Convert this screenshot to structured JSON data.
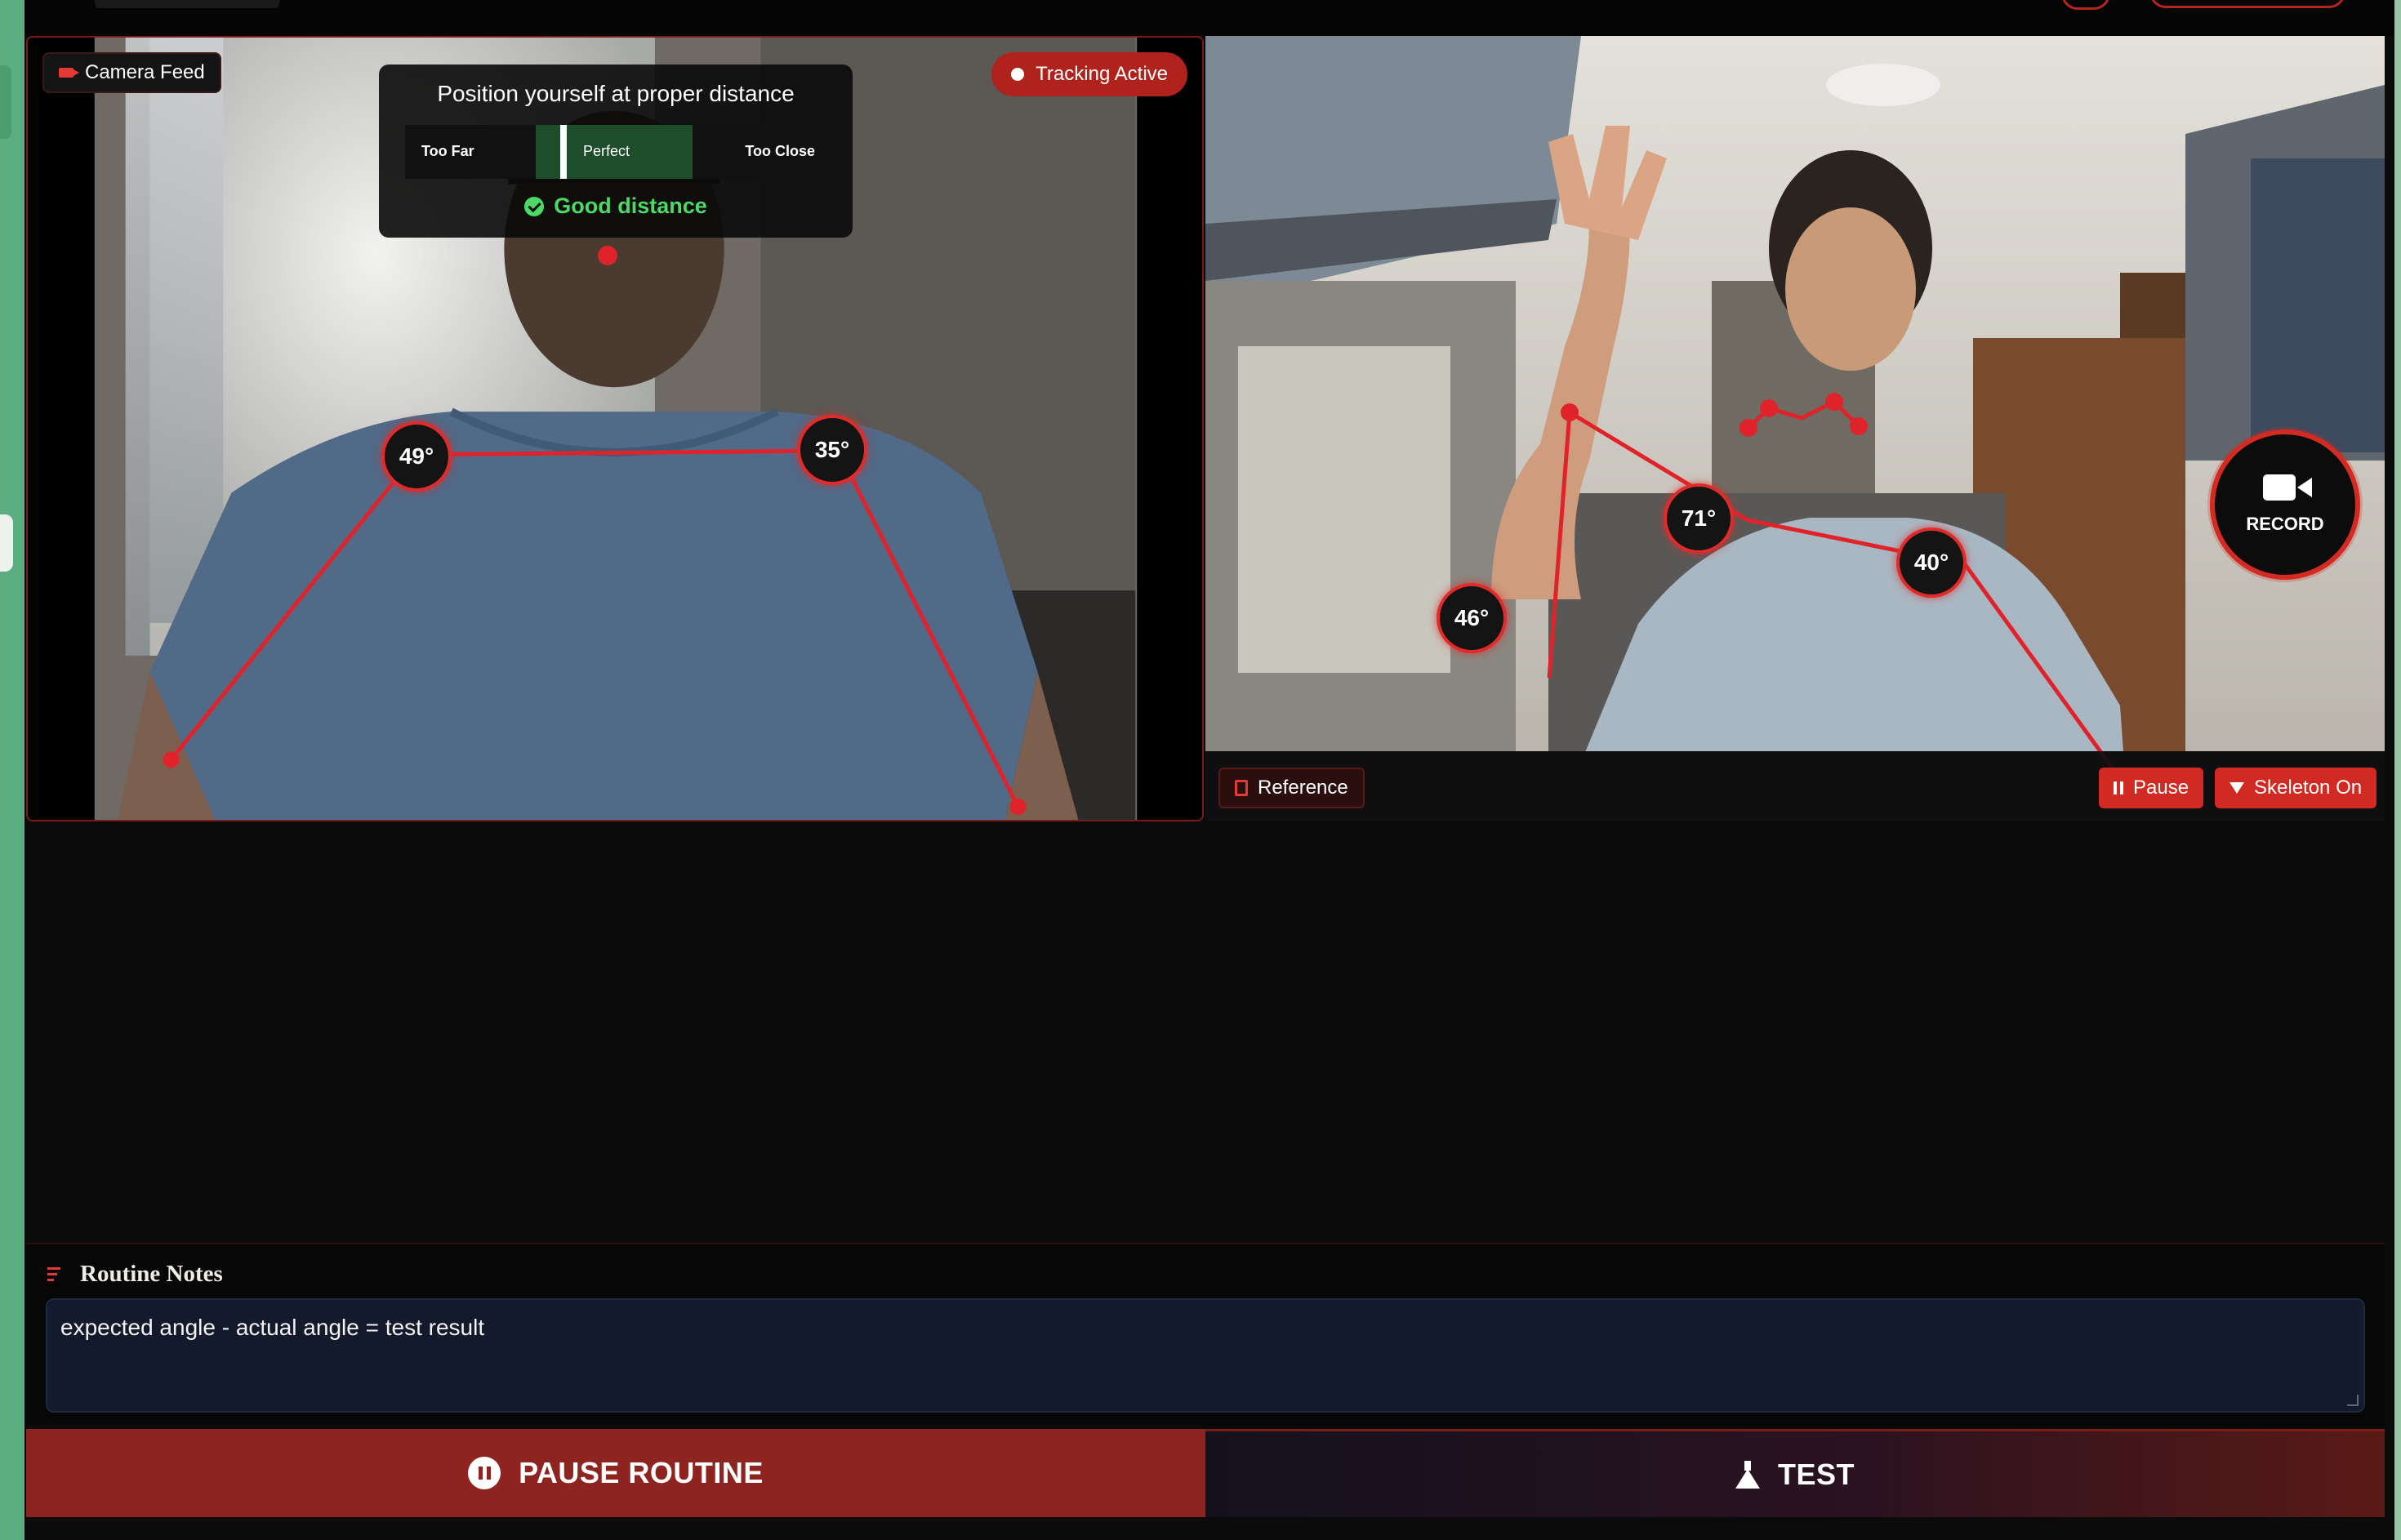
{
  "camera_panel": {
    "badge_label": "Camera Feed",
    "tracking_label": "Tracking Active",
    "distance_guide": {
      "title": "Position yourself at proper distance",
      "too_far_label": "Too Far",
      "perfect_label": "Perfect",
      "too_close_label": "Too Close",
      "status": "Good distance"
    },
    "angles": [
      "49°",
      "35°"
    ]
  },
  "reference_panel": {
    "angles": [
      "71°",
      "46°",
      "40°"
    ],
    "record_label": "RECORD",
    "reference_button": "Reference",
    "pause_button": "Pause",
    "skeleton_button": "Skeleton On"
  },
  "notes": {
    "title": "Routine Notes",
    "text": "expected angle - actual angle = test result"
  },
  "actions": {
    "pause_routine": "PAUSE ROUTINE",
    "test": "TEST"
  },
  "colors": {
    "accent_red": "#d12a22",
    "good_green": "#4cd964",
    "frame_bg": "#0b0b0b",
    "edge_green": "#5cae82"
  },
  "icons": [
    "camera-icon",
    "dot-icon",
    "check-icon",
    "video-camera-icon",
    "reference-icon",
    "pause-icon",
    "filter-icon",
    "notes-icon",
    "pause-circle-icon",
    "flask-icon"
  ]
}
